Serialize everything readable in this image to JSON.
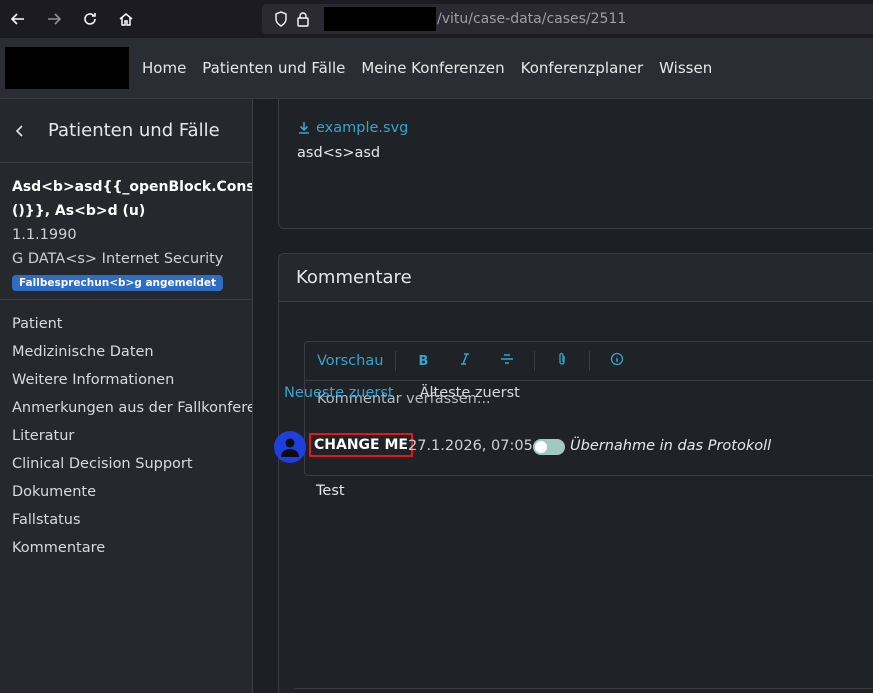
{
  "browser": {
    "url_path": "/vitu/case-data/cases/2511"
  },
  "nav": {
    "items": [
      "Home",
      "Patienten und Fälle",
      "Meine Konferenzen",
      "Konferenzplaner",
      "Wissen"
    ]
  },
  "sidebar": {
    "title": "Patienten und Fälle",
    "patient_name_line1": "Asd<b>asd{{_openBlock.Construc",
    "patient_name_line2": "()}}, As<b>d (u)",
    "birthdate": "1.1.1990",
    "insurance": "G DATA<s> Internet Security",
    "badge": "Fallbesprechun<b>g angemeldet",
    "menu": [
      "Patient",
      "Medizinische Daten",
      "Weitere Informationen",
      "Anmerkungen aus der Fallkonfere",
      "Literatur",
      "Clinical Decision Support",
      "Dokumente",
      "Fallstatus",
      "Kommentare"
    ]
  },
  "document": {
    "file_name": "example.svg",
    "description": "asd<s>asd"
  },
  "comments": {
    "title": "Kommentare",
    "toolbar_preview": "Vorschau",
    "placeholder": "Kommentar verfassen...",
    "sort_newest": "Neueste zuerst",
    "sort_oldest": "Älteste zuerst",
    "entry": {
      "author": "CHANGE ME",
      "time": "27.1.2026, 07:05",
      "protocol_label": "Übernahme in das Protokoll",
      "text": "Test"
    }
  },
  "colors": {
    "accent": "#3aa3c9",
    "badge": "#2f6cc4",
    "highlight": "#e01818",
    "avatar": "#1f3fdc"
  }
}
